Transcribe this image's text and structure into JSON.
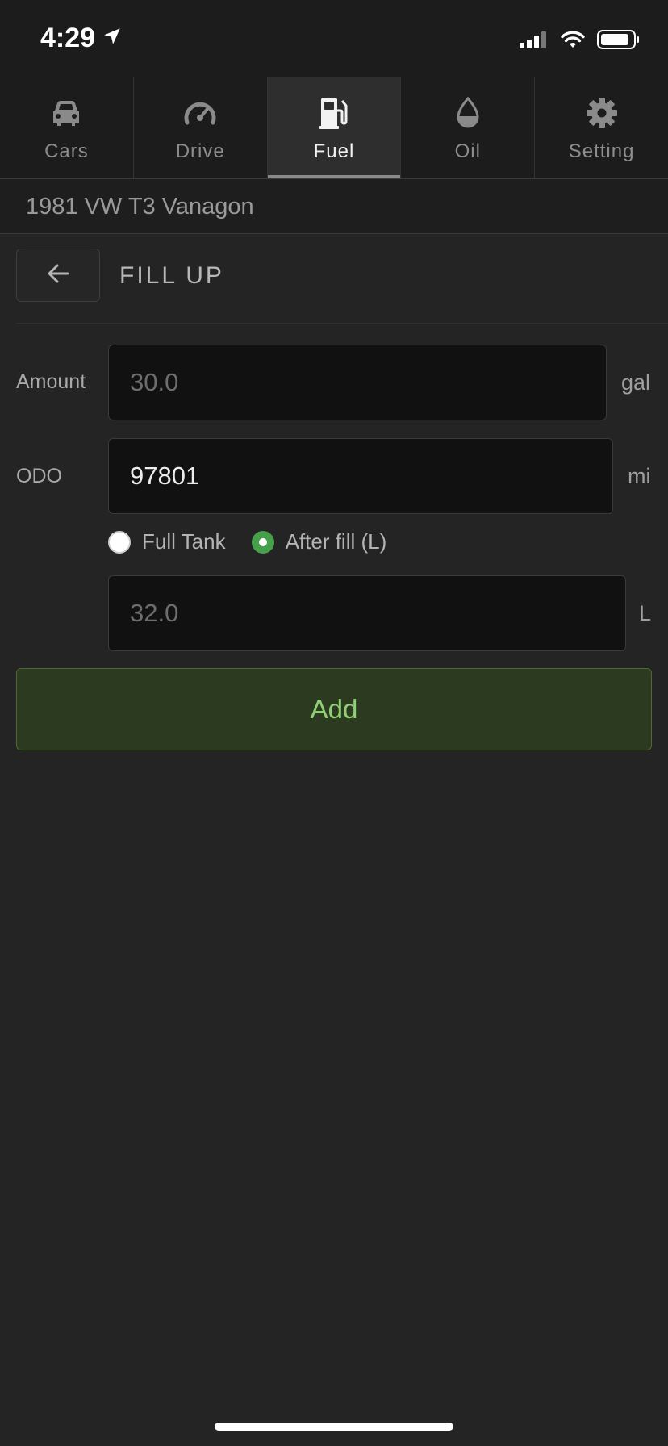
{
  "status_bar": {
    "time": "4:29"
  },
  "tabs": [
    {
      "label": "Cars",
      "icon": "car-icon"
    },
    {
      "label": "Drive",
      "icon": "speedometer-icon"
    },
    {
      "label": "Fuel",
      "icon": "fuel-pump-icon",
      "active": true
    },
    {
      "label": "Oil",
      "icon": "oil-drop-icon"
    },
    {
      "label": "Setting",
      "icon": "gear-icon"
    }
  ],
  "car": {
    "name": "1981 VW T3 Vanagon"
  },
  "header": {
    "title": "FILL UP"
  },
  "form": {
    "amount": {
      "label": "Amount",
      "placeholder": "30.0",
      "unit": "gal"
    },
    "odo": {
      "label": "ODO",
      "value": "97801",
      "unit": "mi"
    },
    "radio_full_tank": {
      "label": "Full Tank",
      "checked": false
    },
    "radio_after_fill": {
      "label": "After fill (L)",
      "checked": true
    },
    "after_fill": {
      "placeholder": "32.0",
      "unit": "L"
    },
    "add_label": "Add"
  },
  "colors": {
    "background": "#242424",
    "accent_green": "#46a04a",
    "add_button_bg": "#2c3a1f",
    "add_button_text": "#8fcf76"
  }
}
